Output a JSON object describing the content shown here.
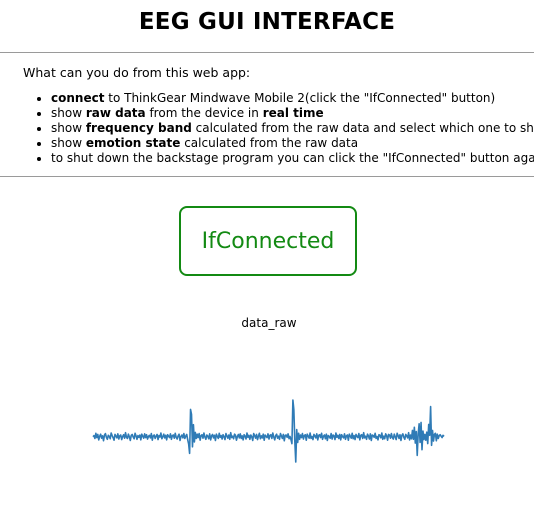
{
  "header": {
    "title": "EEG GUI INTERFACE"
  },
  "intro": {
    "text": "What can you do from this web app:"
  },
  "features": [
    {
      "parts": [
        {
          "text": "connect",
          "bold": true
        },
        {
          "text": " to ThinkGear Mindwave Mobile 2(click the \"IfConnected\" button)",
          "bold": false
        }
      ]
    },
    {
      "parts": [
        {
          "text": "show ",
          "bold": false
        },
        {
          "text": "raw data",
          "bold": true
        },
        {
          "text": " from the device in ",
          "bold": false
        },
        {
          "text": "real time",
          "bold": true
        }
      ]
    },
    {
      "parts": [
        {
          "text": "show ",
          "bold": false
        },
        {
          "text": "frequency band",
          "bold": true
        },
        {
          "text": " calculated from the raw data and select which one to show",
          "bold": false
        }
      ]
    },
    {
      "parts": [
        {
          "text": "show ",
          "bold": false
        },
        {
          "text": "emotion state",
          "bold": true
        },
        {
          "text": " calculated from the raw data",
          "bold": false
        }
      ]
    },
    {
      "parts": [
        {
          "text": "to shut down the backstage program you can click the \"IfConnected\" button again",
          "bold": false
        }
      ]
    }
  ],
  "connect_button": {
    "label": "IfConnected",
    "color": "#138a13"
  },
  "chart_data": {
    "type": "line",
    "title": "data_raw",
    "xlabel": "",
    "ylabel": "",
    "grid": false,
    "line_color": "#2f7bb6",
    "series": [
      {
        "values": [
          0,
          0.4,
          -0.6,
          1.2,
          -0.3,
          0.8,
          -1.1,
          0.2,
          0.9,
          -0.5,
          0.3,
          -1.4,
          0.6,
          1.1,
          -0.2,
          -0.9,
          0.5,
          0.1,
          -0.7,
          1.3,
          0.4,
          -0.3,
          -1.2,
          0.8,
          0.2,
          -0.4,
          1.0,
          -0.8,
          0.3,
          0.6,
          -1.0,
          0.1,
          0.7,
          -0.5,
          1.4,
          -0.2,
          -0.6,
          0.9,
          0.0,
          -1.3,
          0.5,
          0.8,
          -0.1,
          -0.7,
          1.2,
          0.3,
          -0.9,
          0.4,
          -0.2,
          0.6,
          -1.1,
          0.9,
          0.2,
          -0.5,
          1.0,
          -0.3,
          0.7,
          -0.8,
          0.1,
          0.5,
          -0.4,
          1.1,
          -1.2,
          0.3,
          0.6,
          -0.6,
          0.2,
          0.8,
          -1.0,
          0.4,
          -0.1,
          1.3,
          -0.7,
          0.0,
          0.9,
          -0.4,
          0.5,
          -1.1,
          0.7,
          0.2,
          -0.3,
          1.0,
          -0.9,
          0.4,
          0.6,
          -0.5,
          1.2,
          -0.2,
          -0.8,
          0.3,
          0.9,
          -1.3,
          0.1,
          0.6,
          -0.4,
          1.1,
          -0.6,
          0.2,
          0.8,
          -1.0,
          -2.5,
          -5.8,
          9.5,
          7.8,
          -3.5,
          4.2,
          -1.8,
          1.5,
          -0.6,
          0.9,
          -0.3,
          1.1,
          -1.2,
          0.4,
          0.7,
          -0.5,
          1.3,
          -0.1,
          -0.9,
          0.6,
          0.2,
          -0.7,
          1.0,
          -1.1,
          0.3,
          0.8,
          -0.4,
          0.5,
          -1.3,
          0.9,
          0.1,
          -0.6,
          1.2,
          -0.2,
          0.4,
          -0.8,
          0.7,
          0.0,
          -1.0,
          1.1,
          0.3,
          -0.5,
          0.6,
          -0.9,
          1.4,
          -0.3,
          0.2,
          -0.7,
          0.9,
          0.5,
          -1.2,
          0.1,
          0.8,
          -0.4,
          1.0,
          -0.6,
          0.3,
          -1.1,
          0.7,
          0.2,
          -0.8,
          1.3,
          -0.2,
          0.5,
          -0.9,
          0.6,
          0.0,
          -1.3,
          1.1,
          0.4,
          -0.5,
          0.8,
          -1.0,
          0.2,
          1.2,
          -0.7,
          0.3,
          -0.4,
          0.9,
          -1.2,
          0.6,
          0.1,
          -0.3,
          1.0,
          -0.8,
          0.5,
          0.7,
          -0.6,
          1.3,
          -0.1,
          -1.1,
          0.4,
          0.9,
          -0.5,
          0.2,
          -0.9,
          1.1,
          0.3,
          -0.6,
          0.8,
          -1.4,
          0.5,
          0.6,
          -0.2,
          1.0,
          -0.7,
          0.1,
          -1.0,
          -2.4,
          12.8,
          9.5,
          -1.5,
          -8.8,
          2.5,
          -2.0,
          1.2,
          -0.9,
          0.6,
          -0.3,
          1.1,
          -0.8,
          0.4,
          0.7,
          -1.2,
          0.9,
          0.2,
          -0.5,
          1.3,
          -0.6,
          0.1,
          -1.0,
          0.8,
          0.3,
          -0.4,
          1.0,
          -1.1,
          0.5,
          0.7,
          -0.3,
          1.2,
          -0.9,
          0.2,
          0.6,
          -0.7,
          0.9,
          -1.3,
          0.4,
          0.1,
          -0.5,
          1.1,
          -0.8,
          0.6,
          0.3,
          -1.0,
          1.3,
          -0.2,
          0.5,
          -0.6,
          0.8,
          -1.1,
          0.7,
          0.0,
          -0.4,
          1.0,
          -0.9,
          0.3,
          0.6,
          -1.2,
          0.9,
          0.2,
          -0.5,
          1.2,
          -0.7,
          0.4,
          -1.0,
          0.8,
          0.1,
          -0.3,
          1.1,
          -1.1,
          0.5,
          0.7,
          -0.6,
          1.4,
          -0.4,
          0.2,
          -0.9,
          0.9,
          0.3,
          -0.8,
          1.0,
          -1.3,
          0.6,
          0.4,
          -0.2,
          1.2,
          -0.6,
          0.1,
          -1.1,
          0.7,
          0.5,
          -0.4,
          1.3,
          -0.9,
          0.2,
          -0.7,
          1.0,
          0.3,
          -1.2,
          0.8,
          0.6,
          -0.5,
          1.1,
          -0.3,
          -0.8,
          0.9,
          0.0,
          -1.0,
          1.2,
          0.4,
          -0.6,
          0.7,
          -1.3,
          0.5,
          1.0,
          -0.2,
          -0.9,
          0.8,
          0.3,
          -0.4,
          1.4,
          -1.1,
          0.6,
          -0.7,
          2.2,
          -0.9,
          3.3,
          -2.2,
          1.8,
          -6.5,
          1.0,
          4.5,
          -2.0,
          5.0,
          -4.5,
          2.0,
          -1.0,
          0.8,
          -1.2,
          1.6,
          -2.4,
          4.3,
          0.5,
          10.5,
          -3.0,
          2.2,
          -1.5,
          0.8,
          1.2,
          -1.4,
          0.9,
          -0.6,
          0.4,
          0.7,
          0.2,
          -0.3,
          0.5,
          0.1
        ]
      }
    ]
  }
}
